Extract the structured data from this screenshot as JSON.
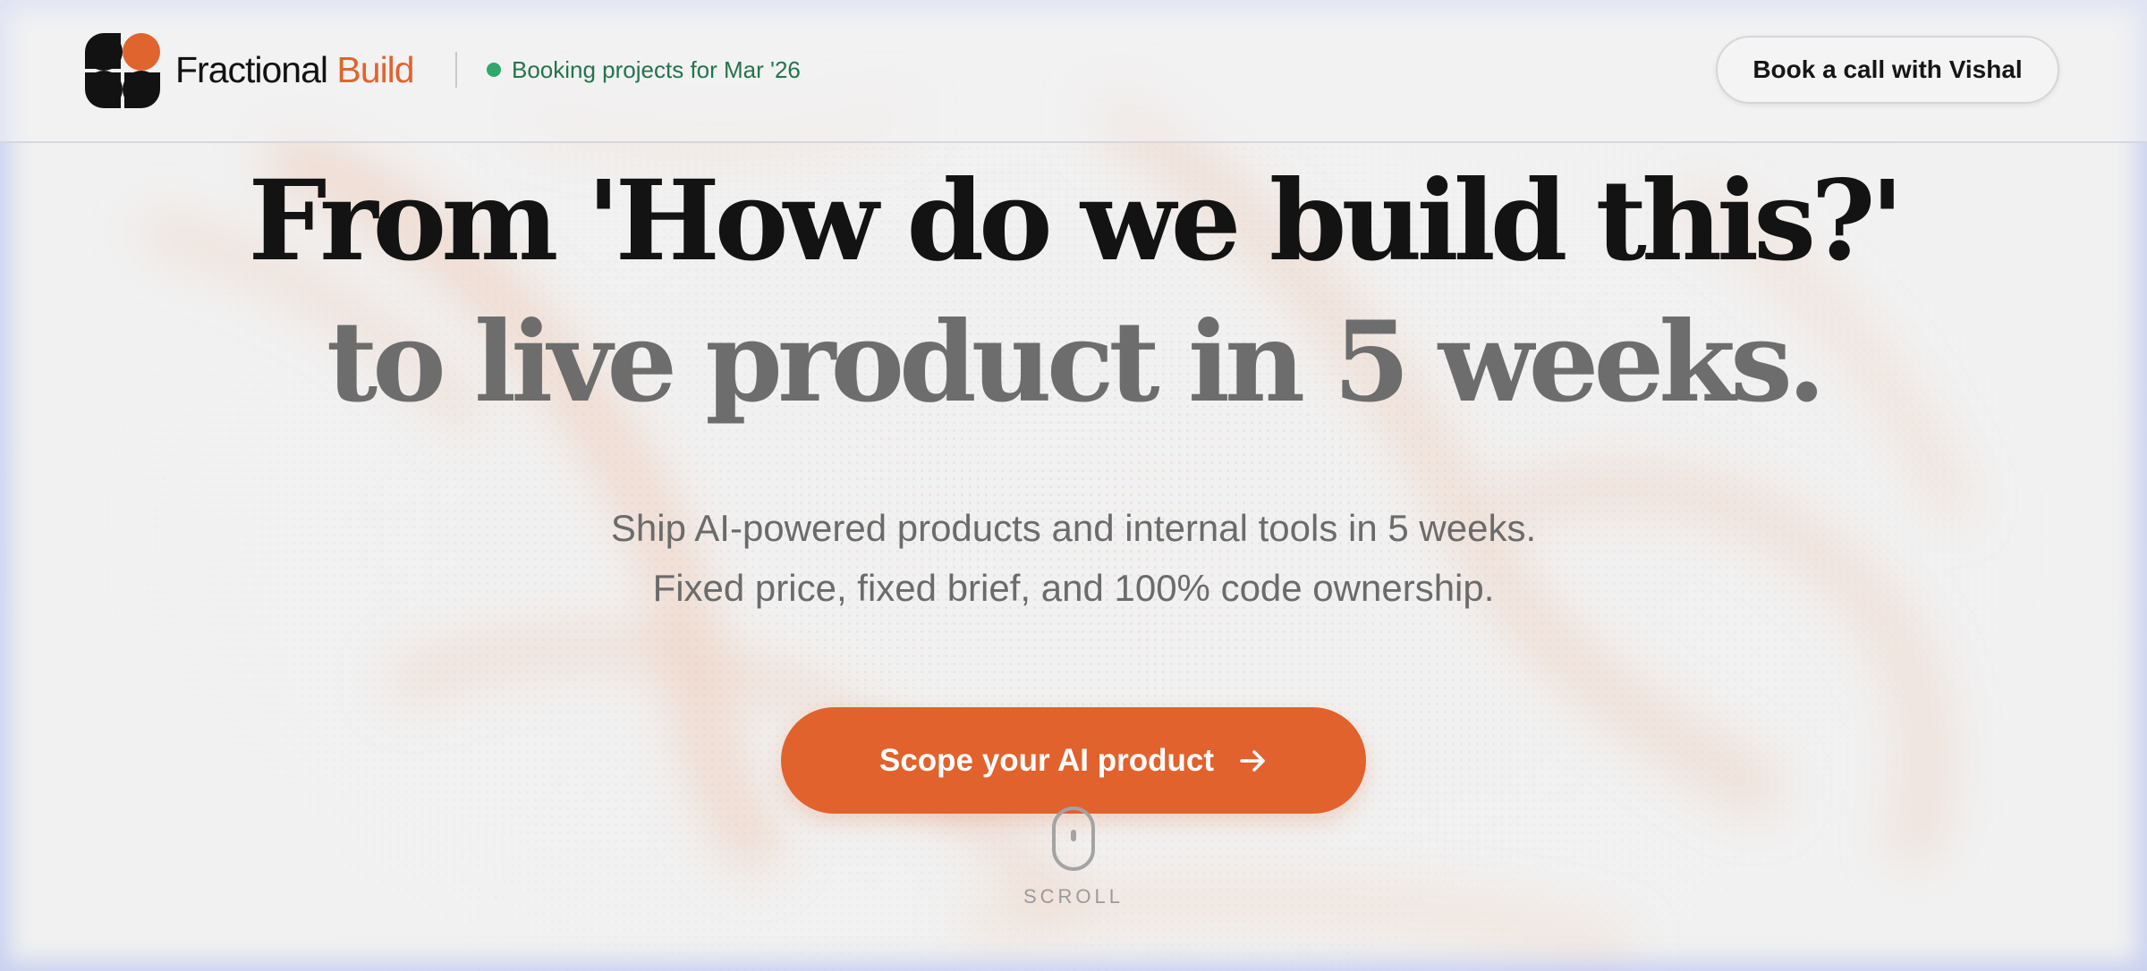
{
  "header": {
    "brand_primary": "Fractional",
    "brand_accent": "Build",
    "status_text": "Booking projects for Mar '26",
    "cta_label": "Book a call with Vishal"
  },
  "hero": {
    "headline_line1": "From 'How do we build this?'",
    "headline_line2": "to live product in 5 weeks.",
    "subtext_line1": "Ship AI-powered products and internal tools in 5 weeks.",
    "subtext_line2": "Fixed price, fixed brief, and 100% code ownership.",
    "cta_label": "Scope your AI product",
    "cta_icon": "arrow-right-icon",
    "scroll_label": "SCROLL",
    "scroll_icon": "mouse-icon"
  },
  "logo_icon": "four-petal-logo",
  "colors": {
    "accent": "#e1622d",
    "brand_text": "#121212",
    "status_green": "#2fa86a",
    "status_text_green": "#23744c",
    "headline_dark": "#131313",
    "headline_gray": "#6d6d6d",
    "body_gray": "#6b6b6b",
    "page_background": "#f1f1f1",
    "edge_glow": "#b8c4f0"
  }
}
